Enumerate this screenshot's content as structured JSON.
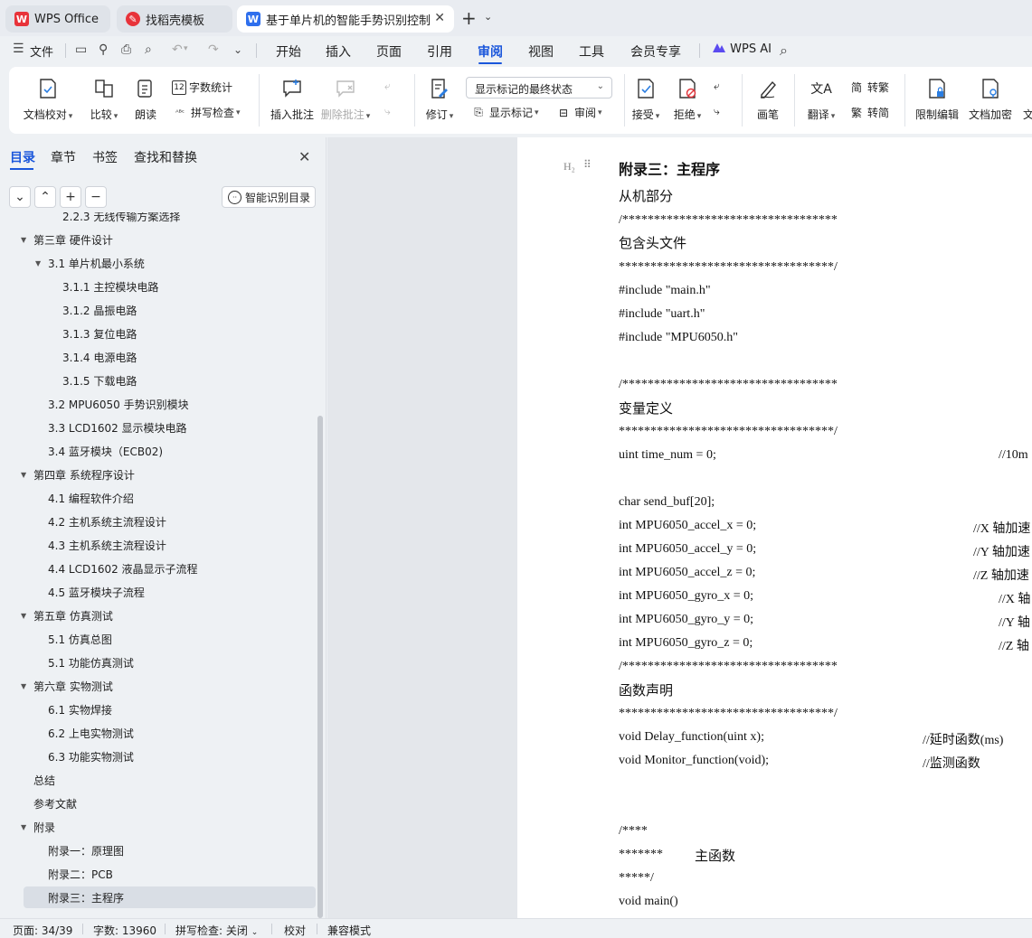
{
  "tabs": [
    {
      "label": "WPS Office",
      "icon": "wps-logo-icon"
    },
    {
      "label": "找稻壳模板",
      "icon": "docer-icon"
    },
    {
      "label": "基于单片机的智能手势识别控制",
      "icon": "wps-writer-icon"
    }
  ],
  "menu": {
    "file": "文件",
    "tabs": [
      "开始",
      "插入",
      "页面",
      "引用",
      "审阅",
      "视图",
      "工具",
      "会员专享"
    ],
    "active_tab": "审阅",
    "ai": "WPS AI"
  },
  "ribbon": {
    "doc_check": "文档校对",
    "compare": "比较",
    "read_aloud": "朗读",
    "word_count": "字数统计",
    "spell_check": "拼写检查",
    "insert_comment": "插入批注",
    "delete_comment": "删除批注",
    "revise": "修订",
    "markup_state": "显示标记的最终状态",
    "show_markup": "显示标记",
    "review": "审阅",
    "accept": "接受",
    "reject": "拒绝",
    "pen": "画笔",
    "translate": "翻译",
    "to_traditional": "转繁",
    "to_simplified": "转简",
    "restrict_edit": "限制编辑",
    "doc_encrypt": "文档加密",
    "more": "文"
  },
  "panel": {
    "tabs": [
      "目录",
      "章节",
      "书签",
      "查找和替换"
    ],
    "active_tab": "目录",
    "smart_toc": "智能识别目录"
  },
  "toc": [
    {
      "label": "2.2.3  无线传输方案选择",
      "level": 3,
      "arrow": ""
    },
    {
      "label": "第三章  硬件设计",
      "level": 1,
      "arrow": "▼"
    },
    {
      "label": "3.1 单片机最小系统",
      "level": 2,
      "arrow": "▼"
    },
    {
      "label": "3.1.1 主控模块电路",
      "level": 3,
      "arrow": ""
    },
    {
      "label": "3.1.2  晶振电路",
      "level": 3,
      "arrow": ""
    },
    {
      "label": "3.1.3  复位电路",
      "level": 3,
      "arrow": ""
    },
    {
      "label": "3.1.4  电源电路",
      "level": 3,
      "arrow": ""
    },
    {
      "label": "3.1.5 下载电路",
      "level": 3,
      "arrow": ""
    },
    {
      "label": "3.2 MPU6050 手势识别模块",
      "level": 2,
      "arrow": ""
    },
    {
      "label": "3.3 LCD1602 显示模块电路",
      "level": 2,
      "arrow": ""
    },
    {
      "label": "3.4  蓝牙模块（ECB02)",
      "level": 2,
      "arrow": ""
    },
    {
      "label": "第四章  系统程序设计",
      "level": 1,
      "arrow": "▼"
    },
    {
      "label": "4.1  编程软件介绍",
      "level": 2,
      "arrow": ""
    },
    {
      "label": "4.2  主机系统主流程设计",
      "level": 2,
      "arrow": ""
    },
    {
      "label": "4.3  主机系统主流程设计",
      "level": 2,
      "arrow": ""
    },
    {
      "label": "4.4 LCD1602 液晶显示子流程",
      "level": 2,
      "arrow": ""
    },
    {
      "label": "4.5  蓝牙模块子流程",
      "level": 2,
      "arrow": ""
    },
    {
      "label": "第五章  仿真测试",
      "level": 1,
      "arrow": "▼"
    },
    {
      "label": "5.1 仿真总图",
      "level": 2,
      "arrow": ""
    },
    {
      "label": "5.1 功能仿真测试",
      "level": 2,
      "arrow": ""
    },
    {
      "label": "第六章  实物测试",
      "level": 1,
      "arrow": "▼"
    },
    {
      "label": "6.1 实物焊接",
      "level": 2,
      "arrow": ""
    },
    {
      "label": "6.2  上电实物测试",
      "level": 2,
      "arrow": ""
    },
    {
      "label": "6.3 功能实物测试",
      "level": 2,
      "arrow": ""
    },
    {
      "label": "总结",
      "level": 1,
      "arrow": ""
    },
    {
      "label": "参考文献",
      "level": 1,
      "arrow": ""
    },
    {
      "label": "附录",
      "level": 1,
      "arrow": "▼"
    },
    {
      "label": "附录一：原理图",
      "level": 2,
      "arrow": ""
    },
    {
      "label": "附录二：PCB",
      "level": 2,
      "arrow": ""
    },
    {
      "label": "附录三：主程序",
      "level": 2,
      "arrow": "",
      "selected": true
    }
  ],
  "doc": {
    "h2_marker": "H₂",
    "heading": "附录三：主程序",
    "lines": [
      {
        "text": "从机部分",
        "style": "cjk",
        "comment": ""
      },
      {
        "text": "/**********************************",
        "style": "code",
        "comment": ""
      },
      {
        "text": "包含头文件",
        "style": "cjk",
        "comment": ""
      },
      {
        "text": "**********************************/",
        "style": "code",
        "comment": ""
      },
      {
        "text": "#include \"main.h\"",
        "style": "code",
        "comment": ""
      },
      {
        "text": "#include \"uart.h\"",
        "style": "code",
        "comment": ""
      },
      {
        "text": "#include \"MPU6050.h\"",
        "style": "code",
        "comment": ""
      },
      {
        "text": "/**********************************",
        "style": "code",
        "comment": ""
      },
      {
        "text": "变量定义",
        "style": "cjk",
        "comment": ""
      },
      {
        "text": "**********************************/",
        "style": "code",
        "comment": ""
      },
      {
        "text": "uint time_num = 0;",
        "style": "code",
        "comment": "//10m"
      },
      {
        "text": "char send_buf[20];",
        "style": "code",
        "comment": ""
      },
      {
        "text": "int MPU6050_accel_x = 0;",
        "style": "code",
        "comment": "//X 轴加速"
      },
      {
        "text": "int MPU6050_accel_y = 0;",
        "style": "code",
        "comment": "//Y 轴加速"
      },
      {
        "text": "int MPU6050_accel_z = 0;",
        "style": "code",
        "comment": "//Z 轴加速"
      },
      {
        "text": "int MPU6050_gyro_x = 0;",
        "style": "code",
        "comment": "//X 轴"
      },
      {
        "text": "int MPU6050_gyro_y = 0;",
        "style": "code",
        "comment": "//Y 轴"
      },
      {
        "text": "int MPU6050_gyro_z = 0;",
        "style": "code",
        "comment": "//Z 轴"
      },
      {
        "text": "/**********************************",
        "style": "code",
        "comment": ""
      },
      {
        "text": "函数声明",
        "style": "cjk",
        "comment": ""
      },
      {
        "text": "**********************************/",
        "style": "code",
        "comment": ""
      },
      {
        "text": "void Delay_function(uint x);",
        "style": "code",
        "comment": "//延时函数(ms)"
      },
      {
        "text": "void Monitor_function(void);",
        "style": "code",
        "comment": "//监测函数"
      },
      {
        "text": "/****",
        "style": "code",
        "comment": ""
      },
      {
        "text": "*******",
        "style": "code",
        "comment": "主函数"
      },
      {
        "text": "*****/",
        "style": "code",
        "comment": ""
      },
      {
        "text": "void main()",
        "style": "code",
        "comment": ""
      }
    ]
  },
  "status": {
    "page": "页面: 34/39",
    "words": "字数: 13960",
    "spell": "拼写检查: 关闭",
    "proof": "校对",
    "compat": "兼容模式"
  }
}
